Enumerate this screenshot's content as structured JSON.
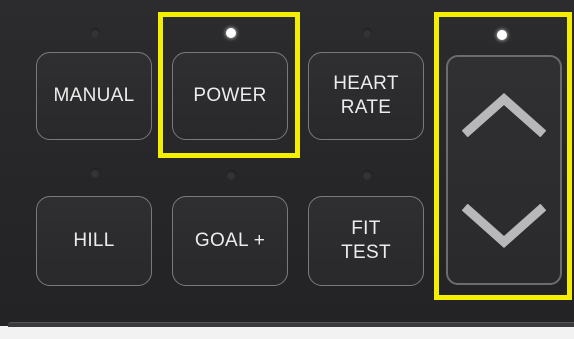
{
  "panel": {
    "buttons": {
      "manual": "MANUAL",
      "power": "POWER",
      "heart_rate": "HEART\nRATE",
      "hill": "HILL",
      "goal_plus": "GOAL +",
      "fit_test": "FIT\nTEST"
    },
    "indicators": {
      "power_led": "on",
      "arrows_led": "on",
      "other_leds": "off"
    },
    "arrows": {
      "up_icon": "chevron-up-icon",
      "down_icon": "chevron-down-icon"
    },
    "colors": {
      "panel_bg": "#2a2a2c",
      "button_border": "#7a7a7c",
      "button_text": "#ececec",
      "highlight": "#f4ee00",
      "led_on": "#ffffff"
    }
  }
}
